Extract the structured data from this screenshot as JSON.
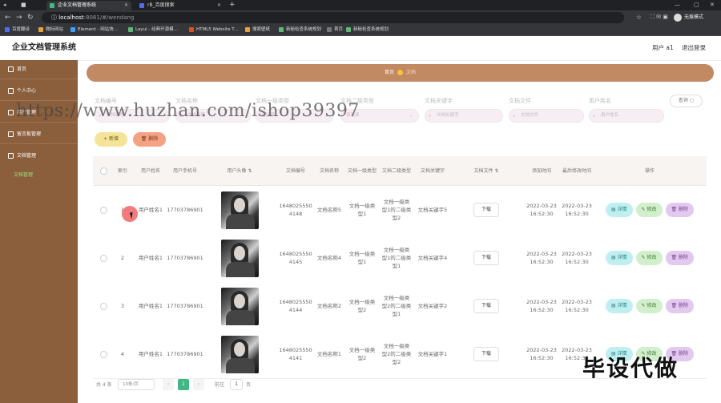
{
  "browser": {
    "tabs": [
      {
        "title": "企业文档管理系统",
        "active": true
      },
      {
        "title": "rB_百度搜索",
        "active": false
      }
    ],
    "url_host": "localhost",
    "url_rest": ":8081/#/wendang",
    "profile_label": "无痕模式",
    "bookmarks": [
      "百度翻译",
      "微标网站",
      "Element - 网站快...",
      "Layui - 经典开源模...",
      "HTML5 Website T...",
      "搜索壁纸",
      "新秘检查系统规划",
      "首页",
      "新秘检查系统规划"
    ]
  },
  "header": {
    "title": "企业文档管理系统",
    "user": "用户 a1",
    "logout": "退出登录"
  },
  "sidebar": {
    "items": [
      {
        "label": "首页"
      },
      {
        "label": "个人中心"
      },
      {
        "label": "用户管理"
      },
      {
        "label": "留言板管理"
      },
      {
        "label": "文档管理"
      }
    ],
    "sub_item": "文档管理"
  },
  "breadcrumb": {
    "home": "首页",
    "current": "文档"
  },
  "filters": {
    "labels": [
      "文档编号",
      "文档名称",
      "文档一级类型",
      "文档二级类型",
      "文档关键字",
      "文档文件",
      "用户姓名"
    ],
    "placeholders": [
      "文档编号",
      "文档名称",
      "请选择",
      "请选择",
      "文档关键字",
      "文档文件",
      "用户姓名"
    ],
    "search": "查询"
  },
  "actions": {
    "add": "新增",
    "delete": "删除"
  },
  "table": {
    "headers": [
      "索引",
      "用户姓名",
      "用户手机号",
      "用户头像",
      "文档编号",
      "文档名称",
      "文档一级类型",
      "文档二级类型",
      "文档关键字",
      "文档文件",
      "添加时间",
      "最后修改时间",
      "操作"
    ],
    "download": "下载",
    "op_view": "详情",
    "op_edit": "修改",
    "op_delete": "删除",
    "rows": [
      {
        "index": "1",
        "name": "用户姓名1",
        "phone": "17703786901",
        "doc_no": "16480255504148",
        "doc_name": "文档名称5",
        "type1": "文档一级类型1",
        "type2": "文档一级类型1的二级类型2",
        "keyword": "文档关键字5",
        "added": "2022-03-23 16:52:30",
        "modified": "2022-03-23 16:52:30"
      },
      {
        "index": "2",
        "name": "用户姓名1",
        "phone": "17703786901",
        "doc_no": "16480255504145",
        "doc_name": "文档名称4",
        "type1": "文档一级类型1",
        "type2": "文档一级类型1的二级类型1",
        "keyword": "文档关键字4",
        "added": "2022-03-23 16:52:30",
        "modified": "2022-03-23 16:52:30"
      },
      {
        "index": "3",
        "name": "用户姓名1",
        "phone": "17703786901",
        "doc_no": "16480255504144",
        "doc_name": "文档名称2",
        "type1": "文档一级类型2",
        "type2": "文档一级类型2的二级类型1",
        "keyword": "文档关键字2",
        "added": "2022-03-23 16:52:30",
        "modified": "2022-03-23 16:52:30"
      },
      {
        "index": "4",
        "name": "用户姓名1",
        "phone": "17703786901",
        "doc_no": "16480255504141",
        "doc_name": "文档名称1",
        "type1": "文档一级类型2",
        "type2": "文档一级类型2的二级类型2",
        "keyword": "文档关键字1",
        "added": "2022-03-23 16:52:30",
        "modified": "2022-03-23 16:52:30"
      }
    ]
  },
  "pagination": {
    "total": "共 4 条",
    "page_size": "10条/页",
    "prev": "‹",
    "current": "1",
    "next": "›",
    "goto": "前往",
    "goto_value": "1",
    "page_unit": "页"
  },
  "overlay": {
    "watermark": "https://www.huzhan.com/ishop39397",
    "stamp": "毕设代做"
  },
  "colors": {
    "sidebar": "#8b5e3c",
    "breadcrumb": "#c28a63",
    "add": "#f5e398",
    "delete": "#f4a284",
    "view": "#bfeff0",
    "edit": "#d2efcb",
    "remove": "#e2c9ef",
    "pager_current": "#41b883"
  }
}
